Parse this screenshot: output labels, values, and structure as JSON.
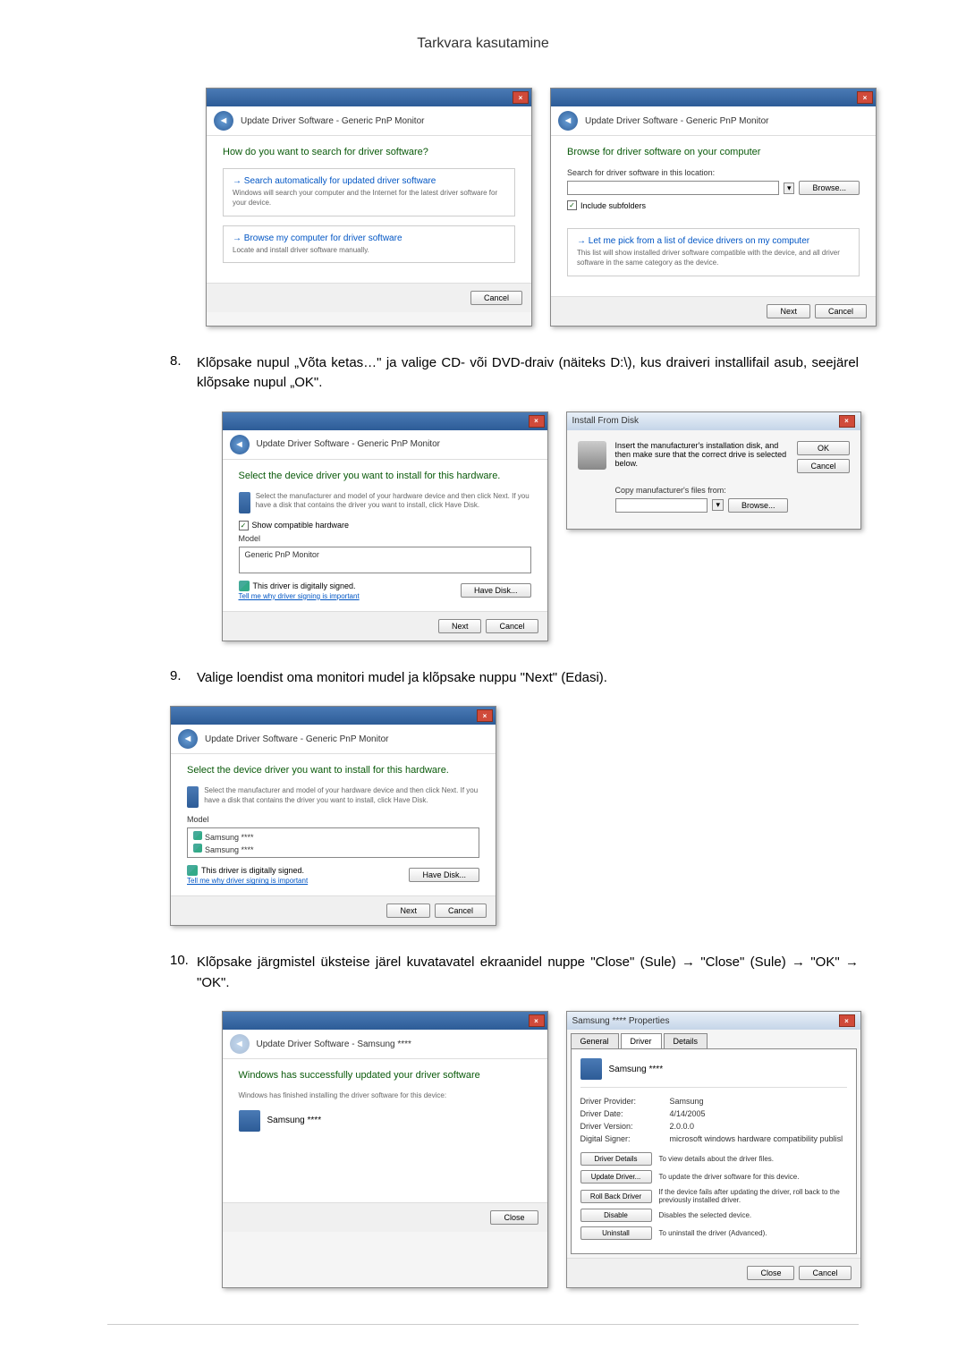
{
  "page_header": "Tarkvara kasutamine",
  "steps": {
    "s8": {
      "num": "8.",
      "text": "Klõpsake nupul „Võta ketas…\" ja valige CD- või DVD-draiv (näiteks D:\\), kus draiveri installifail asub, seejärel klõpsake nupul „OK\"."
    },
    "s9": {
      "num": "9.",
      "text": "Valige loendist oma monitori mudel ja klõpsake nuppu \"Next\" (Edasi)."
    },
    "s10": {
      "num": "10.",
      "text": "Klõpsake järgmistel üksteise järel kuvatavatel ekraanidel nuppe \"Close\" (Sule) → \"Close\" (Sule) → \"OK\" → \"OK\"."
    }
  },
  "dialogs": {
    "nav_title": "Update Driver Software - Generic PnP Monitor",
    "d1_heading": "How do you want to search for driver software?",
    "d1_opt1_title": "Search automatically for updated driver software",
    "d1_opt1_desc": "Windows will search your computer and the Internet for the latest driver software for your device.",
    "d1_opt2_title": "Browse my computer for driver software",
    "d1_opt2_desc": "Locate and install driver software manually.",
    "d2_heading": "Browse for driver software on your computer",
    "d2_search_label": "Search for driver software in this location:",
    "d2_include": "Include subfolders",
    "d2_pick_title": "Let me pick from a list of device drivers on my computer",
    "d2_pick_desc": "This list will show installed driver software compatible with the device, and all driver software in the same category as the device.",
    "d3_heading": "Select the device driver you want to install for this hardware.",
    "d3_desc": "Select the manufacturer and model of your hardware device and then click Next. If you have a disk that contains the driver you want to install, click Have Disk.",
    "d3_show_compat": "Show compatible hardware",
    "d3_model": "Model",
    "d3_item": "Generic PnP Monitor",
    "d3_signed": "This driver is digitally signed.",
    "d3_tell": "Tell me why driver signing is important",
    "d4_title": "Install From Disk",
    "d4_msg": "Insert the manufacturer's installation disk, and then make sure that the correct drive is selected below.",
    "d4_copy": "Copy manufacturer's files from:",
    "d5_heading": "Select the device driver you want to install for this hardware.",
    "d5_item": "Samsung ****",
    "d6_heading": "Windows has successfully updated your driver software",
    "d6_msg": "Windows has finished installing the driver software for this device:",
    "props_title": "Samsung **** Properties",
    "props_name": "Samsung ****",
    "props_provider_label": "Driver Provider:",
    "props_provider": "Samsung",
    "props_date_label": "Driver Date:",
    "props_date": "4/14/2005",
    "props_version_label": "Driver Version:",
    "props_version": "2.0.0.0",
    "props_signer_label": "Digital Signer:",
    "props_signer": "microsoft windows hardware compatibility publisl",
    "ac_details": "Driver Details",
    "ac_details_desc": "To view details about the driver files.",
    "ac_update": "Update Driver...",
    "ac_update_desc": "To update the driver software for this device.",
    "ac_rollback": "Roll Back Driver",
    "ac_rollback_desc": "If the device fails after updating the driver, roll back to the previously installed driver.",
    "ac_disable": "Disable",
    "ac_disable_desc": "Disables the selected device.",
    "ac_uninstall": "Uninstall",
    "ac_uninstall_desc": "To uninstall the driver (Advanced).",
    "tabs": {
      "general": "General",
      "driver": "Driver",
      "details": "Details"
    }
  },
  "buttons": {
    "cancel": "Cancel",
    "next": "Next",
    "browse": "Browse...",
    "have_disk": "Have Disk...",
    "ok": "OK",
    "close": "Close"
  }
}
